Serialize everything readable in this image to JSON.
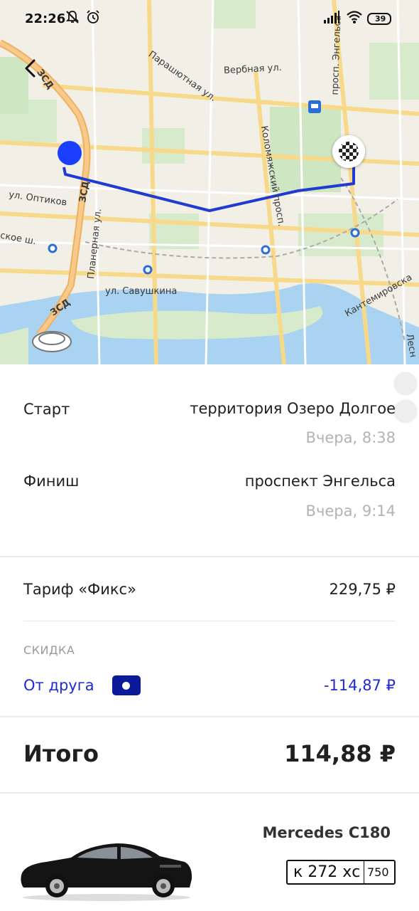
{
  "status_bar": {
    "time": "22:26",
    "battery": "39",
    "icons": [
      "notifications-off-icon",
      "alarm-icon",
      "signal-icon",
      "wifi-icon",
      "battery-icon"
    ]
  },
  "map": {
    "labels": {
      "zsd_1": "ЗСД",
      "zsd_2": "ЗСД",
      "zsd_3": "ЗСД",
      "paraschutnaya": "Парашютная ул.",
      "verbnaya": "Вербная ул.",
      "kolomyazhsky": "Коломяжский просп.",
      "prosp_engelsa": "просп. Энгельса",
      "optikov": "ул. Оптиков",
      "planernaya": "Планерная ул.",
      "primorskoe": "ское ш.",
      "savushkina": "ул. Савушкина",
      "kantemirovskaya": "Кантемировска",
      "les": "Лесн"
    }
  },
  "trip": {
    "start_label": "Старт",
    "start_address": "территория Озеро Долгое",
    "start_time": "Вчера, 8:38",
    "finish_label": "Финиш",
    "finish_address": "проспект Энгельса",
    "finish_time": "Вчера, 9:14"
  },
  "pricing": {
    "tariff_label": "Тариф «Фикс»",
    "tariff_value": "229,75 ₽",
    "discount_heading": "СКИДКА",
    "discount_label": "От друга",
    "discount_value": "-114,87 ₽",
    "total_label": "Итого",
    "total_value": "114,88 ₽"
  },
  "car": {
    "model": "Mercedes C180",
    "plate_number": "к 272 хс",
    "plate_region": "750"
  },
  "colors": {
    "route": "#1f3bd1",
    "accent_blue": "#1e2bd1",
    "badge": "#0a1a99"
  }
}
